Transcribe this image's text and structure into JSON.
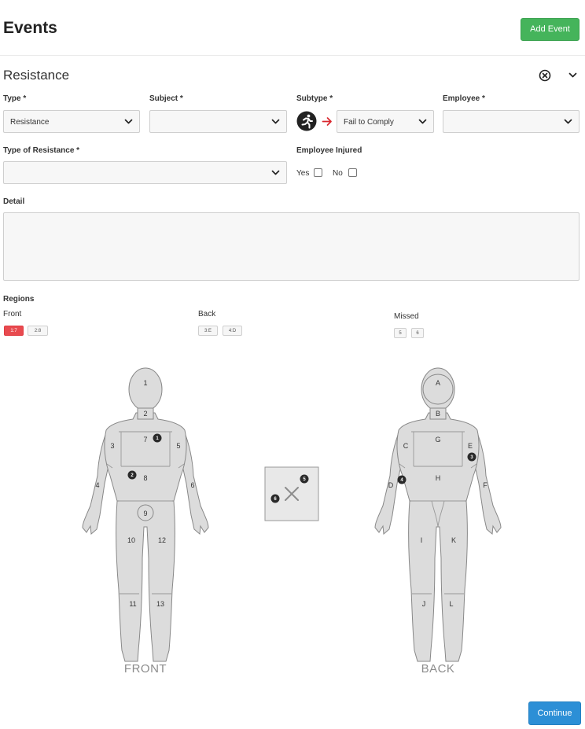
{
  "header": {
    "title": "Events",
    "add_button": "Add Event"
  },
  "section": {
    "title": "Resistance"
  },
  "fields": {
    "type": {
      "label": "Type *",
      "value": "Resistance"
    },
    "subject": {
      "label": "Subject *",
      "value": ""
    },
    "subtype": {
      "label": "Subtype *",
      "value": "Fail to Comply"
    },
    "employee": {
      "label": "Employee *",
      "value": ""
    },
    "type_of_resistance": {
      "label": "Type of Resistance *",
      "value": ""
    },
    "employee_injured": {
      "label": "Employee Injured",
      "yes": "Yes",
      "no": "No"
    },
    "detail": {
      "label": "Detail",
      "value": ""
    }
  },
  "regions": {
    "label": "Regions",
    "front": {
      "label": "Front",
      "badges": [
        "1:7",
        "2:8"
      ]
    },
    "back": {
      "label": "Back",
      "badges": [
        "3:E",
        "4:D"
      ]
    },
    "missed": {
      "label": "Missed",
      "badges": [
        "5",
        "6"
      ]
    }
  },
  "diagram": {
    "front_label": "FRONT",
    "back_label": "BACK",
    "front_regions": [
      "1",
      "2",
      "3",
      "4",
      "5",
      "6",
      "7",
      "8",
      "9",
      "10",
      "11",
      "12",
      "13"
    ],
    "back_regions": [
      "A",
      "B",
      "C",
      "D",
      "E",
      "F",
      "G",
      "H",
      "I",
      "J",
      "K",
      "L"
    ],
    "markers": [
      "1",
      "2",
      "3",
      "4",
      "5",
      "6"
    ]
  },
  "footer": {
    "continue": "Continue"
  },
  "colors": {
    "green": "#45b45b",
    "blue": "#2c8fd6",
    "red": "#e84a4f",
    "arrow_red": "#d9272e"
  },
  "icons": [
    "close-circle-icon",
    "chevron-down-icon",
    "running-person-icon",
    "arrow-right-icon"
  ]
}
